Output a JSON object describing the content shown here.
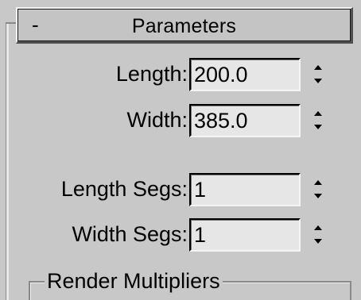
{
  "rollout": {
    "title": "Parameters",
    "collapse_glyph": "-",
    "collapse_icon": "minus-icon"
  },
  "fields": {
    "length": {
      "label": "Length:",
      "value": "200.0"
    },
    "width": {
      "label": "Width:",
      "value": "385.0"
    },
    "length_segs": {
      "label": "Length Segs:",
      "value": "1"
    },
    "width_segs": {
      "label": "Width Segs:",
      "value": "1"
    }
  },
  "spinner_icon": "spinner-arrows-icon",
  "group": {
    "title": "Render Multipliers"
  },
  "colors": {
    "panel_bg": "#c8c8c8",
    "field_bg": "#e6e6e6",
    "text": "#000000"
  }
}
